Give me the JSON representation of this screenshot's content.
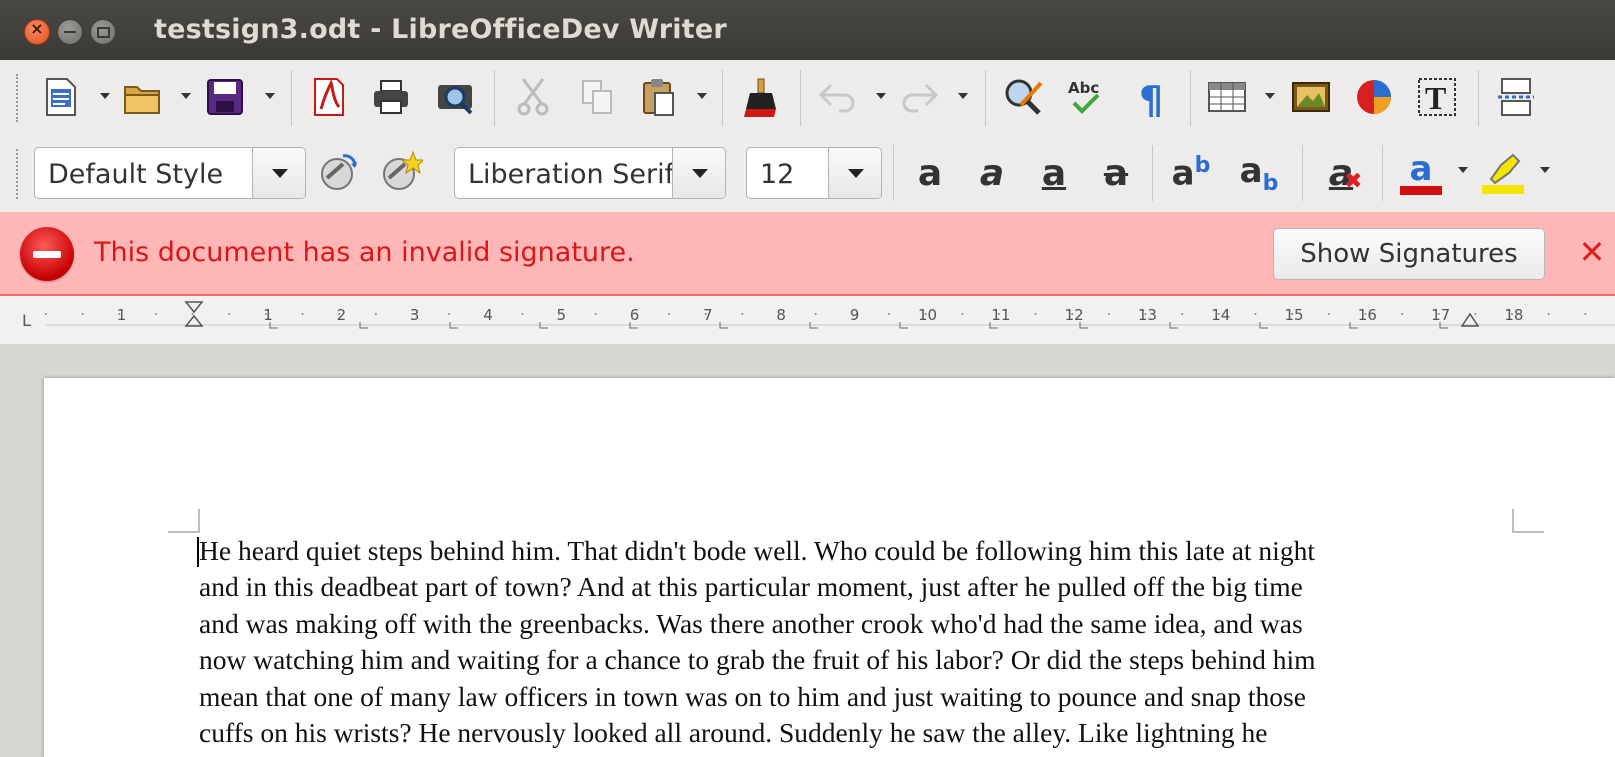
{
  "window": {
    "title": "testsign3.odt - LibreOfficeDev Writer"
  },
  "standard_toolbar": {
    "icons": [
      "new-document-icon",
      "open-folder-icon",
      "save-icon",
      "export-pdf-icon",
      "print-icon",
      "print-preview-icon",
      "cut-icon",
      "copy-icon",
      "paste-icon",
      "clone-formatting-icon",
      "undo-icon",
      "redo-icon",
      "find-replace-icon",
      "spellcheck-icon",
      "formatting-marks-icon",
      "table-icon",
      "image-icon",
      "chart-icon",
      "text-box-icon",
      "page-break-icon"
    ]
  },
  "formatting_toolbar": {
    "paragraph_style": "Default Style",
    "font_name": "Liberation Serif",
    "font_size": "12",
    "bold_glyph": "a",
    "italic_glyph": "a",
    "underline_glyph": "a",
    "strike_glyph": "a",
    "superscript_glyph": "a",
    "superscript_mark": "b",
    "subscript_glyph": "a",
    "subscript_mark": "b",
    "clear_glyph": "a",
    "font_color_glyph": "a",
    "font_color": "#d01010",
    "highlight_color": "#f5e600"
  },
  "infobar": {
    "message": "This document has an invalid signature.",
    "button_label": "Show Signatures",
    "close_glyph": "✕",
    "background": "#ffb6b6",
    "text_color": "#d81818"
  },
  "ruler": {
    "numbers": [
      "1",
      "1",
      "2",
      "3",
      "4",
      "5",
      "6",
      "7",
      "8",
      "9",
      "10",
      "11",
      "12",
      "13",
      "14",
      "15",
      "16",
      "17",
      "18"
    ]
  },
  "document": {
    "lines": [
      "He heard quiet steps behind him. That didn't bode well. Who could be following him this late at night",
      "and in this deadbeat part of town? And at this particular moment, just after he pulled off the big time",
      "and was making off with the greenbacks. Was there another crook who'd had the same idea, and was",
      "now watching him and waiting for a chance to grab the fruit of his labor? Or did the steps behind him",
      "mean that one of many law officers in town was on to him and just waiting to pounce and snap those",
      "cuffs on his wrists? He nervously looked all around. Suddenly he saw the alley. Like lightning he"
    ]
  }
}
